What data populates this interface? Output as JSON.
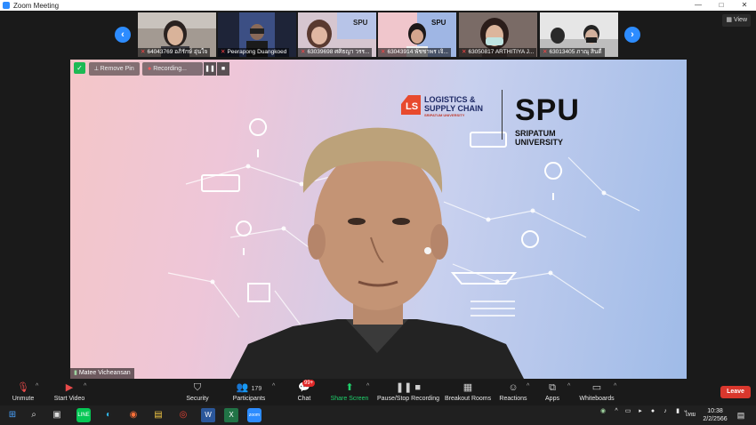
{
  "window": {
    "title": "Zoom Meeting",
    "controls": [
      "—",
      "□",
      "✕"
    ]
  },
  "gallery": {
    "prev": "‹",
    "next": "›",
    "view_label": "View",
    "tiles": [
      {
        "name": "64043769 อภิรักษ์ อุ่นใจ",
        "color": "#9a8f86"
      },
      {
        "name": "Peerapong Duangkoed",
        "color": "#3b4b7a"
      },
      {
        "name": "63039698 ศศิธญา วรร...",
        "color": "#b9a7b0"
      },
      {
        "name": "63043914 พัชชาพร เจิ...",
        "color": "#8aa0d0"
      },
      {
        "name": "63050817 ARTHITIYA J...",
        "color": "#8a6d63"
      },
      {
        "name": "63013405 ภาณุ สินดี",
        "color": "#cfcfcf"
      }
    ]
  },
  "main": {
    "remove_pin": "Remove Pin",
    "recording": "Recording...",
    "speaker": "Matee Vicheansan",
    "banner": {
      "lsc_line1": "LOGISTICS &",
      "lsc_line2": "SUPPLY CHAIN",
      "lsc_sub": "SRIPATUM UNIVERSITY",
      "spu": "SPU",
      "spu_line1": "SRIPATUM",
      "spu_line2": "UNIVERSITY"
    }
  },
  "toolbar": {
    "unmute": "Unmute",
    "start_video": "Start Video",
    "security": "Security",
    "participants": "Participants",
    "participants_count": "179",
    "chat": "Chat",
    "chat_badge": "99+",
    "share_screen": "Share Screen",
    "pause_recording": "Pause/Stop Recording",
    "breakout": "Breakout Rooms",
    "reactions": "Reactions",
    "apps": "Apps",
    "whiteboards": "Whiteboards",
    "leave": "Leave"
  },
  "taskbar": {
    "time": "10:38",
    "date": "2/2/2566",
    "lang": "ไทย"
  }
}
